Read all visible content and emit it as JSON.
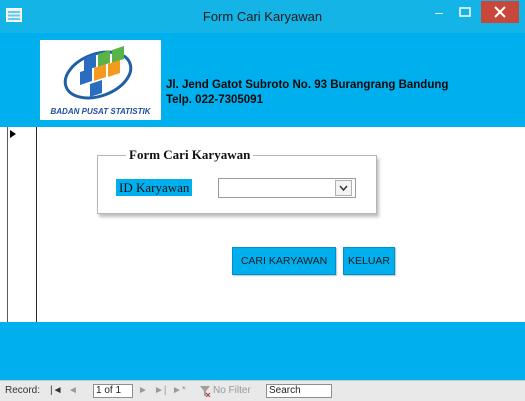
{
  "window": {
    "title": "Form Cari Karyawan",
    "minimize_glyph": "–"
  },
  "header": {
    "logo_text": "BADAN PUSAT STATISTIK",
    "address_line1": "Jl. Jend Gatot Subroto No. 93 Burangrang Bandung",
    "address_line2": "Telp. 022-7305091"
  },
  "form": {
    "group_title": "Form Cari Karyawan",
    "id_label": "ID Karyawan",
    "id_value": ""
  },
  "buttons": {
    "search": "CARI KARYAWAN",
    "exit": "KELUAR"
  },
  "record_nav": {
    "label": "Record:",
    "first": "|◄",
    "prev": "◄",
    "position": "1 of 1",
    "next": "►",
    "last": "►|",
    "new": "►*",
    "filter": "No Filter",
    "search_placeholder": "Search"
  },
  "colors": {
    "accent": "#00b0ee",
    "title_bar": "#14b4e6",
    "close": "#c7483b"
  }
}
